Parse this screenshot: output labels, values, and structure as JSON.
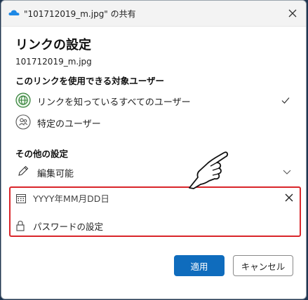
{
  "window": {
    "title": "\"101712019_m.jpg\" の共有"
  },
  "heading": "リンクの設定",
  "filename": "101712019_m.jpg",
  "audience": {
    "label": "このリンクを使用できる対象ユーザー",
    "options": [
      {
        "label": "リンクを知っているすべてのユーザー",
        "icon": "globe-icon",
        "selected": true
      },
      {
        "label": "特定のユーザー",
        "icon": "people-icon",
        "selected": false
      }
    ]
  },
  "other_settings": {
    "label": "その他の設定",
    "permission": {
      "label": "編集可能",
      "icon": "pencil-icon"
    },
    "expiry": {
      "placeholder": "YYYY年MM月DD日",
      "value": "",
      "icon": "calendar-icon"
    },
    "password": {
      "label": "パスワードの設定",
      "icon": "lock-icon"
    }
  },
  "buttons": {
    "apply": "適用",
    "cancel": "キャンセル"
  },
  "colors": {
    "accent": "#0f6cbd",
    "highlight_border": "#d9252a",
    "titlebar": "#f3f3f3"
  }
}
